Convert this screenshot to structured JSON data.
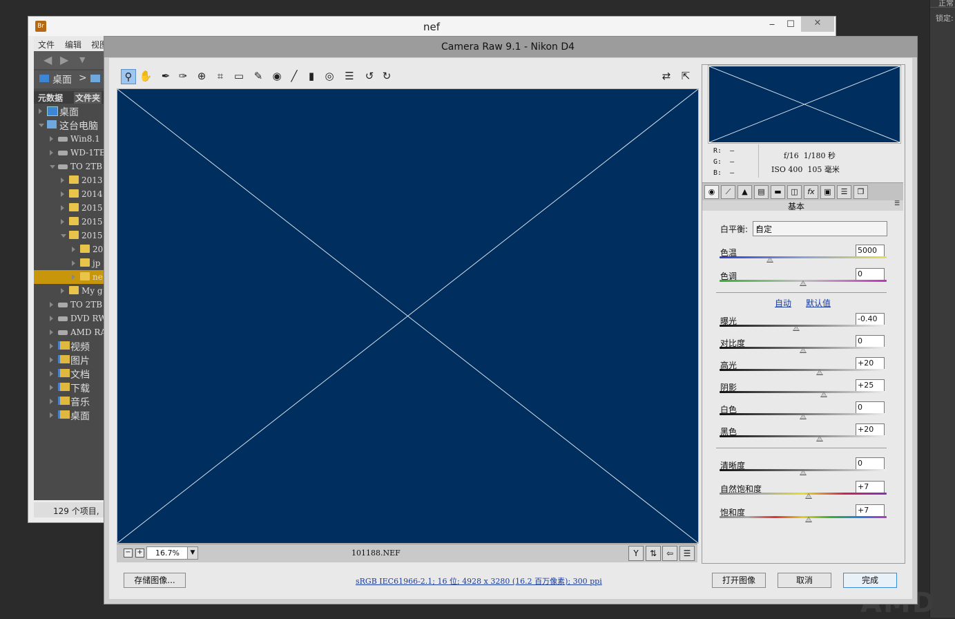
{
  "photoshop": {
    "top_label": "正常",
    "lock_label": "锁定:"
  },
  "watermark": "AMD",
  "bridge": {
    "app_icon": "Br",
    "title": "nef",
    "menu": [
      "文件",
      "编辑",
      "视图"
    ],
    "breadcrumb": [
      "桌面",
      ">"
    ],
    "tabs": [
      "元数据",
      "文件夹"
    ],
    "tree": [
      {
        "label": "桌面",
        "level": 0,
        "icon": "desktop-icon",
        "open": false
      },
      {
        "label": "这台电脑",
        "level": 0,
        "icon": "computer-icon",
        "open": true
      },
      {
        "label": "Win8.1",
        "level": 1,
        "icon": "drive-icon",
        "open": false
      },
      {
        "label": "WD-1TB",
        "level": 1,
        "icon": "drive-icon",
        "open": false
      },
      {
        "label": "TO 2TB",
        "level": 1,
        "icon": "drive-icon",
        "open": true
      },
      {
        "label": "2013",
        "level": 2,
        "icon": "folder-icon",
        "open": false
      },
      {
        "label": "2014",
        "level": 2,
        "icon": "folder-icon",
        "open": false
      },
      {
        "label": "2015",
        "level": 2,
        "icon": "folder-icon",
        "open": false
      },
      {
        "label": "2015",
        "level": 2,
        "icon": "folder-icon",
        "open": false
      },
      {
        "label": "2015",
        "level": 2,
        "icon": "folder-icon",
        "open": true
      },
      {
        "label": "20",
        "level": 3,
        "icon": "folder-icon",
        "open": false
      },
      {
        "label": "jp",
        "level": 3,
        "icon": "folder-icon",
        "open": false
      },
      {
        "label": "ne",
        "level": 3,
        "icon": "folder-icon",
        "open": false,
        "selected": true
      },
      {
        "label": "My g",
        "level": 2,
        "icon": "folder-icon",
        "open": false
      },
      {
        "label": "TO 2TB",
        "level": 1,
        "icon": "drive-icon",
        "open": false
      },
      {
        "label": "DVD RW",
        "level": 1,
        "icon": "dvd-icon",
        "open": false
      },
      {
        "label": "AMD RA",
        "level": 1,
        "icon": "drive-icon",
        "open": false
      },
      {
        "label": "视频",
        "level": 1,
        "icon": "library-icon",
        "open": false
      },
      {
        "label": "图片",
        "level": 1,
        "icon": "library-icon",
        "open": false
      },
      {
        "label": "文档",
        "level": 1,
        "icon": "library-icon",
        "open": false
      },
      {
        "label": "下载",
        "level": 1,
        "icon": "library-icon",
        "open": false
      },
      {
        "label": "音乐",
        "level": 1,
        "icon": "library-icon",
        "open": false
      },
      {
        "label": "桌面",
        "level": 1,
        "icon": "library-icon",
        "open": false
      }
    ],
    "status": "129 个项目,"
  },
  "camera_raw": {
    "title": "Camera Raw 9.1 -  Nikon D4",
    "zoom": "16.7%",
    "filename": "101188.NEF",
    "rgb": {
      "r_label": "R:",
      "g_label": "G:",
      "b_label": "B:",
      "r": "—",
      "g": "—",
      "b": "—"
    },
    "exif": {
      "aperture": "f/16",
      "shutter": "1/180 秒",
      "iso": "ISO 400",
      "focal": "105 毫米"
    },
    "section_title": "基本",
    "white_balance": {
      "label": "白平衡:",
      "value": "自定"
    },
    "auto_link": "自动",
    "default_link": "默认值",
    "sliders": [
      {
        "label": "色温",
        "value": "5000",
        "pos": 0.3,
        "group": "wb",
        "track": "temp"
      },
      {
        "label": "色调",
        "value": "0",
        "pos": 0.5,
        "group": "wb",
        "track": "tint"
      },
      {
        "label": "曝光",
        "value": "-0.40",
        "pos": 0.46,
        "group": "tone",
        "track": "gray"
      },
      {
        "label": "对比度",
        "value": "0",
        "pos": 0.5,
        "group": "tone",
        "track": "gray"
      },
      {
        "label": "高光",
        "value": "+20",
        "pos": 0.6,
        "group": "tone",
        "track": "gray"
      },
      {
        "label": "阴影",
        "value": "+25",
        "pos": 0.625,
        "group": "tone",
        "track": "gray"
      },
      {
        "label": "白色",
        "value": "0",
        "pos": 0.5,
        "group": "tone",
        "track": "gray"
      },
      {
        "label": "黑色",
        "value": "+20",
        "pos": 0.6,
        "group": "tone",
        "track": "gray"
      },
      {
        "label": "清晰度",
        "value": "0",
        "pos": 0.5,
        "group": "presence",
        "track": "gray"
      },
      {
        "label": "自然饱和度",
        "value": "+7",
        "pos": 0.535,
        "group": "presence",
        "track": "vib"
      },
      {
        "label": "饱和度",
        "value": "+7",
        "pos": 0.535,
        "group": "presence",
        "track": "sat"
      }
    ],
    "buttons": {
      "save": "存储图像...",
      "open": "打开图像",
      "cancel": "取消",
      "done": "完成"
    },
    "workflow": "sRGB IEC61966-2.1; 16 位; 4928 x 3280 (16.2 百万像素); 300 ppi"
  },
  "colors": {
    "preview_bg": "#002f5f",
    "selection": "#c8960a"
  }
}
